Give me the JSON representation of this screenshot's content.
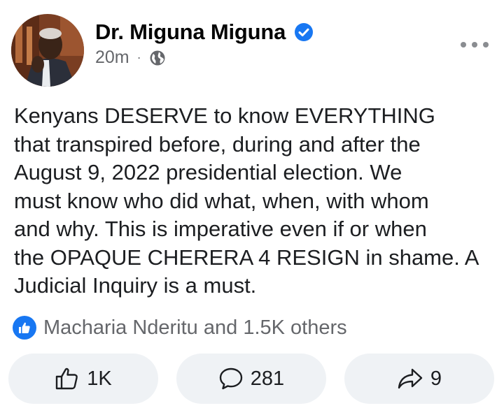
{
  "post": {
    "author": "Dr. Miguna Miguna",
    "time": "20m",
    "separator": "·",
    "icons": {
      "verified": "verified-badge-icon",
      "audience": "globe-icon",
      "more": "more-options-icon"
    },
    "text_lines": [
      "Kenyans DESERVE to know EVERYTHING",
      "that transpired before, during and after the",
      "August 9, 2022 presidential election. We",
      "must know who did what, when, with whom",
      "and why. This is imperative even if or when",
      "the OPAQUE CHERERA 4 RESIGN in shame. A",
      "Judicial Inquiry is a must."
    ]
  },
  "reactions": {
    "summary": "Macharia Nderitu and 1.5K others",
    "icon": "like-reaction-icon"
  },
  "actions": {
    "like_count": "1K",
    "comment_count": "281",
    "share_count": "9"
  },
  "colors": {
    "accent": "#1877f2",
    "secondary_text": "#65676b",
    "button_bg": "#eff2f5"
  }
}
